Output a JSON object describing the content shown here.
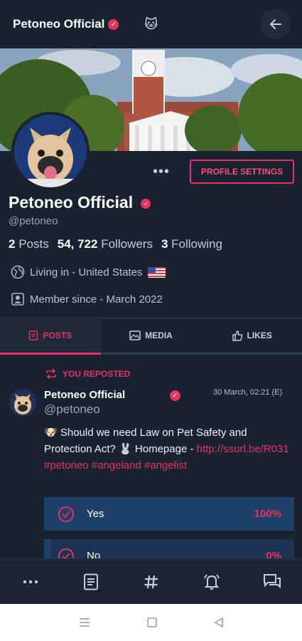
{
  "header": {
    "title": "Petoneo Official",
    "emoji": "🐱"
  },
  "profile": {
    "name": "Petoneo Official",
    "handle": "@petoneo",
    "settings_label": "PROFILE SETTINGS",
    "more_label": "•••",
    "posts_count": "2",
    "posts_label": "Posts",
    "followers_count": "54, 722",
    "followers_label": "Followers",
    "following_count": "3",
    "following_label": "Following",
    "location": "Living in - United States",
    "member_since": "Member since - March 2022"
  },
  "tabs": [
    {
      "label": "POSTS",
      "active": true
    },
    {
      "label": "MEDIA",
      "active": false
    },
    {
      "label": "LIKES",
      "active": false
    }
  ],
  "post": {
    "repost_label": "YOU REPOSTED",
    "author": "Petoneo Official",
    "handle": "@petoneo",
    "time": "30 March, 02:21  (E)",
    "text_part1": "🐶 Should we need Law on Pet Safety and Protection Act? 🐰 Homepage -",
    "text_link": "http://ssurl.be/R031 #petoneo #angeland #angelist",
    "poll": [
      {
        "label": "Yes",
        "percent": "100%"
      },
      {
        "label": "No",
        "percent": "0%"
      }
    ]
  },
  "bottom_nav": [
    "more-icon",
    "document-icon",
    "hashtag-icon",
    "notification-bell-icon",
    "messages-icon"
  ],
  "colors": {
    "accent": "#e4335f",
    "background": "#192230",
    "poll_fill": "#1e4069"
  }
}
